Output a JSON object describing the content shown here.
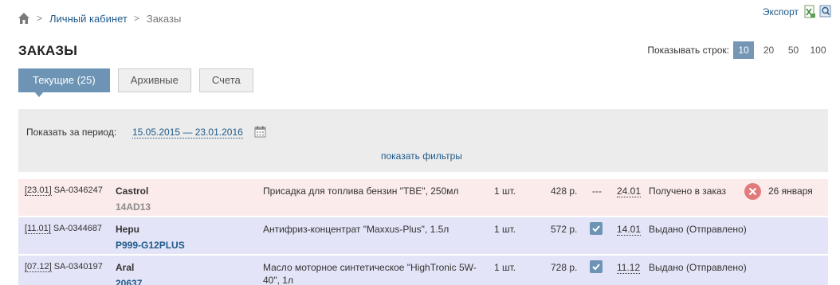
{
  "breadcrumb": {
    "home_icon": "home-icon",
    "items": [
      {
        "label": "Личный кабинет"
      },
      {
        "label": "Заказы"
      }
    ]
  },
  "export": {
    "label": "Экспорт",
    "icons": [
      "excel-icon",
      "help-icon"
    ]
  },
  "page": {
    "title": "ЗАКАЗЫ"
  },
  "rows_per_page": {
    "label": "Показывать строк:",
    "options": [
      "10",
      "20",
      "50",
      "100"
    ],
    "selected": "10"
  },
  "tabs": [
    {
      "label": "Текущие (25)",
      "active": true
    },
    {
      "label": "Архивные",
      "active": false
    },
    {
      "label": "Счета",
      "active": false
    }
  ],
  "filter": {
    "period_label": "Показать за период:",
    "period_value": "15.05.2015 — 23.01.2016",
    "calendar_icon": "calendar-icon",
    "show_filters": "показать фильтры"
  },
  "orders": [
    {
      "row_color": "#fcebeb",
      "date": "[23.01]",
      "order_no": "SA-0346247",
      "brand": "Castrol",
      "article": "14AD13",
      "description": "Присадка для топлива бензин \"TBE\", 250мл",
      "qty": "1 шт.",
      "price": "428 р.",
      "check": "---",
      "delivery": "24.01",
      "status": "Получено в заказ",
      "eta": "26 января"
    },
    {
      "row_color": "#e3e4f7",
      "date": "[11.01]",
      "order_no": "SA-0344687",
      "brand": "Hepu",
      "article": "P999-G12PLUS",
      "description": "Антифриз-концентрат \"Maxxus-Plus\", 1.5л",
      "qty": "1 шт.",
      "price": "572 р.",
      "check": "checked",
      "delivery": "14.01",
      "status": "Выдано (Отправлено)",
      "eta": ""
    },
    {
      "row_color": "#e3e4f7",
      "date": "[07.12]",
      "order_no": "SA-0340197",
      "brand": "Aral",
      "article": "20637",
      "description": "Масло моторное синтетическое \"HighTronic 5W-40\", 1л",
      "qty": "1 шт.",
      "price": "728 р.",
      "check": "checked",
      "delivery": "11.12",
      "status": "Выдано (Отправлено)",
      "eta": ""
    }
  ]
}
